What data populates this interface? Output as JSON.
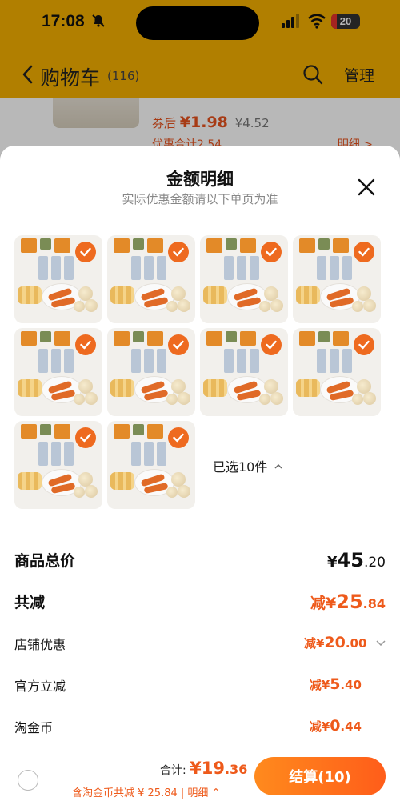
{
  "status_bar": {
    "time": "17:08",
    "battery": "20",
    "battery_level": 0.2
  },
  "nav": {
    "title": "购物车",
    "count": "(116)",
    "manage_label": "管理"
  },
  "background_item": {
    "line": "...",
    "price_prefix": "券后",
    "price": "¥1.98",
    "original_price": "¥4.52",
    "discount_total": "优惠合计2.54",
    "detail_link": "明细 >"
  },
  "sheet": {
    "title": "金额明细",
    "subtitle": "实际优惠金额请以下单页为准",
    "selected_count_label": "已选10件",
    "selected_count": 10
  },
  "rows": {
    "total_price": {
      "label": "商品总价",
      "currency": "¥",
      "int": "45",
      "dec": ".20"
    },
    "total_discount": {
      "label": "共减",
      "prefix": "减¥",
      "int": "25",
      "dec": ".84"
    },
    "store_discount": {
      "label": "店铺优惠",
      "prefix": "减¥",
      "int": "20",
      "dec": ".00"
    },
    "official_discount": {
      "label": "官方立减",
      "prefix": "减¥",
      "int": "5",
      "dec": ".40"
    },
    "taojin_coin": {
      "label": "淘金币",
      "prefix": "减¥",
      "int": "0",
      "dec": ".44"
    }
  },
  "bottom_bar": {
    "sum_label": "合计:",
    "sum_currency": "¥",
    "sum_int": "19",
    "sum_dec": ".36",
    "note": "含淘金币共减 ¥ 25.84 | 明细 ^",
    "checkout_label": "结算(10)"
  },
  "colors": {
    "accent": "#ee5a1b",
    "header": "#f6b000",
    "checkout_start": "#ff8a1d",
    "checkout_end": "#ff5d1a"
  },
  "icons": [
    "bell-slash-icon",
    "signal-icon",
    "wifi-icon",
    "battery-icon",
    "chevron-left-icon",
    "search-icon",
    "close-icon",
    "check-icon",
    "chevron-up-icon",
    "chevron-down-icon"
  ]
}
